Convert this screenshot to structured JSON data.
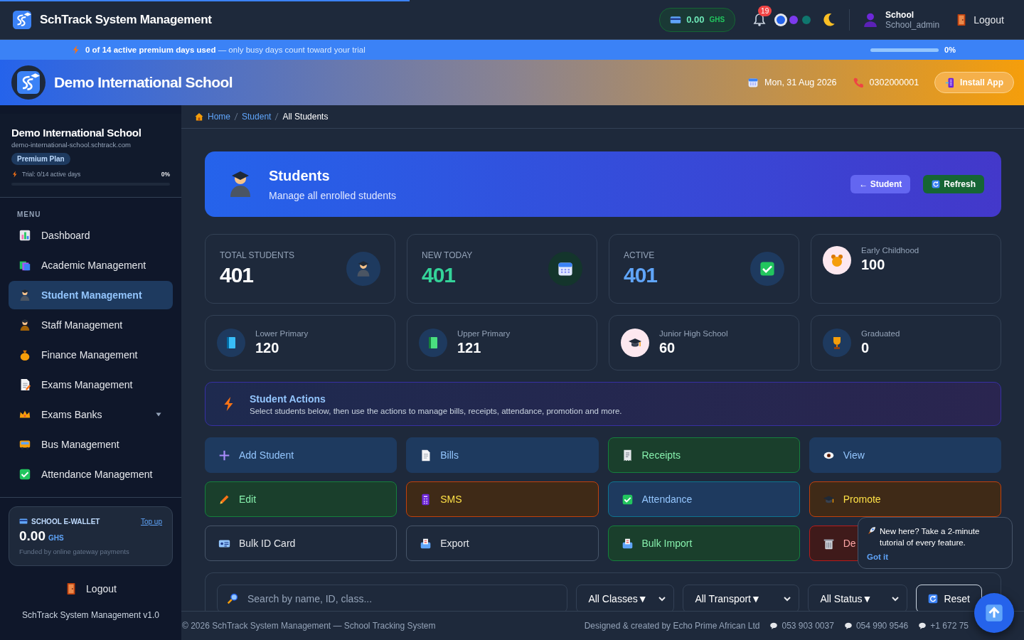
{
  "loading_bar": {
    "level": 0.4
  },
  "app": {
    "title": "SchTrack System Management"
  },
  "header": {
    "wallet": {
      "amount": "0.00",
      "currency": "GHS"
    },
    "notifications": {
      "count": "19"
    },
    "themes": [
      {
        "color": "#2563eb",
        "selected": true
      },
      {
        "color": "#7c3aed",
        "selected": false
      },
      {
        "color": "#0f766e",
        "selected": false
      }
    ],
    "user": {
      "name": "School",
      "role": "School_admin"
    },
    "logout": "Logout"
  },
  "trial_bar": {
    "message": "**0 of 14 active premium days used** — only busy days count toward your trial",
    "level": 0,
    "percent": "0%"
  },
  "school_banner": {
    "name": "Demo International School",
    "date": "Mon, 31 Aug 2026",
    "phone": "0302000001",
    "install": "Install App"
  },
  "sidebar": {
    "school": "Demo International School",
    "url": "demo-international-school.schtrack.com",
    "plan": "Premium Plan",
    "trial": "Trial: 0/14 active days",
    "trial_percent": "0%",
    "trial_progress": {
      "level": 0
    },
    "menu_label": "MENU",
    "items": [
      {
        "label": "Dashboard",
        "selected": false
      },
      {
        "label": "Academic Management",
        "selected": false
      },
      {
        "label": "Student Management",
        "selected": true
      },
      {
        "label": "Staff Management",
        "selected": false
      },
      {
        "label": "Finance Management",
        "selected": false
      },
      {
        "label": "Exams Management",
        "selected": false
      },
      {
        "label": "Exams Banks",
        "selected": false,
        "expanded": false
      },
      {
        "label": "Bus Management",
        "selected": false
      },
      {
        "label": "Attendance Management",
        "selected": false
      }
    ],
    "wallet": {
      "title": "SCHOOL E-WALLET",
      "link": "Top up",
      "amount": "0.00",
      "currency": "GHS",
      "note": "Funded by online gateway payments"
    },
    "logout": "Logout",
    "version": "SchTrack System Management v1.0"
  },
  "breadcrumb": [
    {
      "label": "Home",
      "link": true
    },
    {
      "label": "Student",
      "link": true
    },
    {
      "label": "All Students",
      "link": false
    }
  ],
  "hero": {
    "title": "Students",
    "subtitle": "Manage all enrolled students",
    "buttons": [
      {
        "label": "← Student",
        "kind": "back"
      },
      {
        "label": "Refresh",
        "kind": "refresh"
      }
    ]
  },
  "stats": [
    {
      "kind": "big",
      "label": "TOTAL STUDENTS",
      "value": "401",
      "color": "#ffffff"
    },
    {
      "kind": "big",
      "label": "NEW TODAY",
      "value": "401",
      "color": "#34d399"
    },
    {
      "kind": "big",
      "label": "ACTIVE",
      "value": "401",
      "color": "#60a5fa"
    },
    {
      "kind": "small",
      "label": "Early Childhood",
      "value": "100"
    },
    {
      "kind": "small",
      "label": "Lower Primary",
      "value": "120"
    },
    {
      "kind": "small",
      "label": "Upper Primary",
      "value": "121"
    },
    {
      "kind": "small",
      "label": "Junior High School",
      "value": "60"
    },
    {
      "kind": "small",
      "label": "Graduated",
      "value": "0"
    }
  ],
  "actions_note": {
    "title": "Student Actions",
    "text": "Select students below, then use the actions to manage bills, receipts, attendance, promotion and more."
  },
  "actions": [
    {
      "label": "Add Student",
      "kind": "blue"
    },
    {
      "label": "Bills",
      "kind": "blue"
    },
    {
      "label": "Receipts",
      "kind": "green"
    },
    {
      "label": "View",
      "kind": "blue"
    },
    {
      "label": "Edit",
      "kind": "green"
    },
    {
      "label": "SMS",
      "kind": "orange"
    },
    {
      "label": "Attendance",
      "kind": "teal"
    },
    {
      "label": "Promote",
      "kind": "orange"
    },
    {
      "label": "Bulk ID Card",
      "kind": "plain"
    },
    {
      "label": "Export",
      "kind": "plain"
    },
    {
      "label": "Bulk Import",
      "kind": "green"
    },
    {
      "label": "De",
      "kind": "red"
    }
  ],
  "tour_tip": {
    "text": "New here? Take a 2-minute tutorial of every feature.",
    "button": "Got it"
  },
  "filters": {
    "search_placeholder": "Search by name, ID, class...",
    "selects": [
      "All Classes▼",
      "All Transport▼",
      "All Status▼"
    ],
    "reset": "Reset"
  },
  "footer": {
    "copyright": "© 2026 SchTrack System Management — School Tracking System",
    "credit": "Designed & created by Echo Prime African Ltd",
    "contacts": [
      "053 903 0037",
      "054 990 9546",
      "+1 672 75"
    ]
  }
}
